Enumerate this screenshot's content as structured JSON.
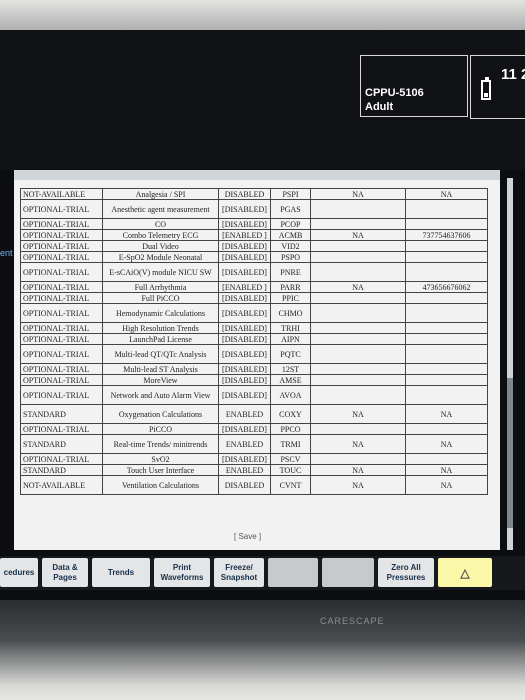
{
  "header": {
    "unit_id": "CPPU-5106",
    "patient_type": "Adult",
    "clock": "11 2"
  },
  "side_tag": "ent",
  "table": {
    "rows": [
      {
        "status": "NOT-AVAILABLE",
        "option": "Analgesia / SPI",
        "state": "DISABLED",
        "code": "PSPI",
        "col5": "NA",
        "col6": "NA"
      },
      {
        "status": "OPTIONAL-TRIAL",
        "option": "Anesthetic agent measurement",
        "state": "[DISABLED]",
        "code": "PGAS",
        "col5": "",
        "col6": ""
      },
      {
        "status": "OPTIONAL-TRIAL",
        "option": "CO",
        "state": "[DISABLED]",
        "code": "PCOP",
        "col5": "",
        "col6": ""
      },
      {
        "status": "OPTIONAL-TRIAL",
        "option": "Combo Telemetry ECG",
        "state": "[ENABLED ]",
        "code": "ACMB",
        "col5": "NA",
        "col6": "737754637606"
      },
      {
        "status": "OPTIONAL-TRIAL",
        "option": "Dual Video",
        "state": "[DISABLED]",
        "code": "VID2",
        "col5": "",
        "col6": ""
      },
      {
        "status": "OPTIONAL-TRIAL",
        "option": "E-SpO2 Module Neonatal",
        "state": "[DISABLED]",
        "code": "PSPO",
        "col5": "",
        "col6": ""
      },
      {
        "status": "OPTIONAL-TRIAL",
        "option": "E-sCAiO(V) module NICU SW",
        "state": "[DISABLED]",
        "code": "PNRE",
        "col5": "",
        "col6": ""
      },
      {
        "status": "OPTIONAL-TRIAL",
        "option": "Full Arrhythmia",
        "state": "[ENABLED ]",
        "code": "PARR",
        "col5": "NA",
        "col6": "473656676062"
      },
      {
        "status": "OPTIONAL-TRIAL",
        "option": "Full PiCCO",
        "state": "[DISABLED]",
        "code": "PPIC",
        "col5": "",
        "col6": ""
      },
      {
        "status": "OPTIONAL-TRIAL",
        "option": "Hemodynamic Calculations",
        "state": "[DISABLED]",
        "code": "CHMO",
        "col5": "",
        "col6": ""
      },
      {
        "status": "OPTIONAL-TRIAL",
        "option": "High Resolution Trends",
        "state": "[DISABLED]",
        "code": "TRHI",
        "col5": "",
        "col6": ""
      },
      {
        "status": "OPTIONAL-TRIAL",
        "option": "LaunchPad License",
        "state": "[DISABLED]",
        "code": "AIPN",
        "col5": "",
        "col6": ""
      },
      {
        "status": "OPTIONAL-TRIAL",
        "option": "Multi-lead QT/QTc Analysis",
        "state": "[DISABLED]",
        "code": "PQTC",
        "col5": "",
        "col6": ""
      },
      {
        "status": "OPTIONAL-TRIAL",
        "option": "Multi-lead ST Analysis",
        "state": "[DISABLED]",
        "code": "12ST",
        "col5": "",
        "col6": ""
      },
      {
        "status": "OPTIONAL-TRIAL",
        "option": "MoreView",
        "state": "[DISABLED]",
        "code": "AMSE",
        "col5": "",
        "col6": ""
      },
      {
        "status": "OPTIONAL-TRIAL",
        "option": "Network and Auto Alarm View",
        "state": "[DISABLED]",
        "code": "AVOA",
        "col5": "",
        "col6": ""
      },
      {
        "status": "STANDARD",
        "option": "Oxygenation Calculations",
        "state": "ENABLED",
        "code": "COXY",
        "col5": "NA",
        "col6": "NA"
      },
      {
        "status": "OPTIONAL-TRIAL",
        "option": "PiCCO",
        "state": "[DISABLED]",
        "code": "PPCO",
        "col5": "",
        "col6": ""
      },
      {
        "status": "STANDARD",
        "option": "Real-time Trends/ minitrends",
        "state": "ENABLED",
        "code": "TRMI",
        "col5": "NA",
        "col6": "NA"
      },
      {
        "status": "OPTIONAL-TRIAL",
        "option": "SvO2",
        "state": "[DISABLED]",
        "code": "PSCV",
        "col5": "",
        "col6": ""
      },
      {
        "status": "STANDARD",
        "option": "Touch User Interface",
        "state": "ENABLED",
        "code": "TOUC",
        "col5": "NA",
        "col6": "NA"
      },
      {
        "status": "NOT-AVAILABLE",
        "option": "Ventilation Calculations",
        "state": "DISABLED",
        "code": "CVNT",
        "col5": "NA",
        "col6": "NA"
      }
    ]
  },
  "save_label": "[ Save ]",
  "nav": {
    "procedures": "cedures",
    "data_pages": "Data & Pages",
    "trends": "Trends",
    "print_waveforms": "Print Waveforms",
    "freeze_snapshot": "Freeze/ Snapshot",
    "zero_all": "Zero All Pressures",
    "alarm_icon": "alarm-bell-icon"
  },
  "brand": "CARESCAPE"
}
